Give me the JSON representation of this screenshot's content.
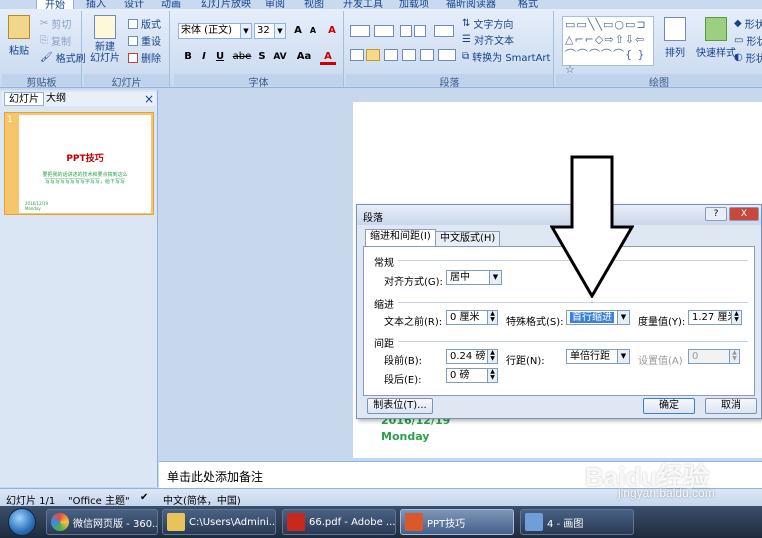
{
  "ribbon": {
    "tabs": [
      "开始",
      "插入",
      "设计",
      "动画",
      "幻灯片放映",
      "审阅",
      "视图",
      "开发工具",
      "加载项",
      "福昕阅读器",
      "格式"
    ],
    "clipboard": {
      "paste": "粘贴",
      "cut": "剪切",
      "copy": "复制",
      "format_painter": "格式刷",
      "title": "剪贴板"
    },
    "slides": {
      "new_slide": "新建\n幻灯片",
      "layout": "版式",
      "reset": "重设",
      "delete": "删除",
      "title": "幻灯片"
    },
    "font": {
      "font_name": "宋体 (正文)",
      "font_size": "32",
      "bold": "B",
      "italic": "I",
      "underline": "U",
      "strike": "abe",
      "shadow": "S",
      "spacing": "AV",
      "case": "Aa",
      "color": "A",
      "grow": "A",
      "shrink": "A",
      "clear": "A",
      "title": "字体"
    },
    "paragraph": {
      "text_direction": "文字方向",
      "align_text": "对齐文本",
      "smartart": "转换为 SmartArt",
      "title": "段落"
    },
    "drawing": {
      "arrange": "排列",
      "quick_styles": "快速样式",
      "shape_fill": "形状",
      "shape_outline": "形状",
      "shape_effects": "形状",
      "title": "绘图"
    }
  },
  "left_panel": {
    "tab_slides": "幻灯片",
    "tab_outline": "大纲",
    "close": "×",
    "thumb_number": "1",
    "thumb_title": "PPT技巧",
    "thumb_line1": "要把我的话讲述的技术和要点搞到这么",
    "thumb_line2": "写写写写写写写写字写写，给下写写",
    "thumb_date": "2016/12/19",
    "thumb_day": "Monday"
  },
  "slide": {
    "date": "2016/12/19",
    "day": "Monday"
  },
  "notes": {
    "placeholder": "单击此处添加备注"
  },
  "status": {
    "slide_count": "幻灯片 1/1",
    "theme": "\"Office 主题\"",
    "language": "中文(简体，中国)"
  },
  "dialog": {
    "title": "段落",
    "help": "?",
    "close": "X",
    "tab_indent": "缩进和间距(I)",
    "tab_chinese": "中文版式(H)",
    "general": "常规",
    "alignment_label": "对齐方式(G):",
    "alignment_value": "居中",
    "indent": "缩进",
    "before_text_label": "文本之前(R):",
    "before_text_value": "0 厘米",
    "special_label": "特殊格式(S):",
    "special_value": "首行缩进",
    "by_label": "度量值(Y):",
    "by_value": "1.27 厘米",
    "spacing": "间距",
    "before_label": "段前(B):",
    "before_value": "0.24 磅",
    "line_spacing_label": "行距(N):",
    "line_spacing_value": "单倍行距",
    "at_label": "设置值(A)",
    "at_value": "0",
    "after_label": "段后(E):",
    "after_value": "0 磅",
    "tabs_button": "制表位(T)...",
    "ok": "确定",
    "cancel": "取消"
  },
  "taskbar": {
    "items": [
      "微信网页版 - 360...",
      "C:\\Users\\Admini...",
      "66.pdf - Adobe ...",
      "PPT技巧",
      "4 - 画图"
    ]
  },
  "watermark": {
    "brand": "Baidu经验",
    "url": "jingyan.baidu.com"
  },
  "colors": {
    "accent": "#c00000",
    "slide_green": "#2aa24a",
    "ribbon": "#dce7f5",
    "selection": "#3b82d8"
  }
}
